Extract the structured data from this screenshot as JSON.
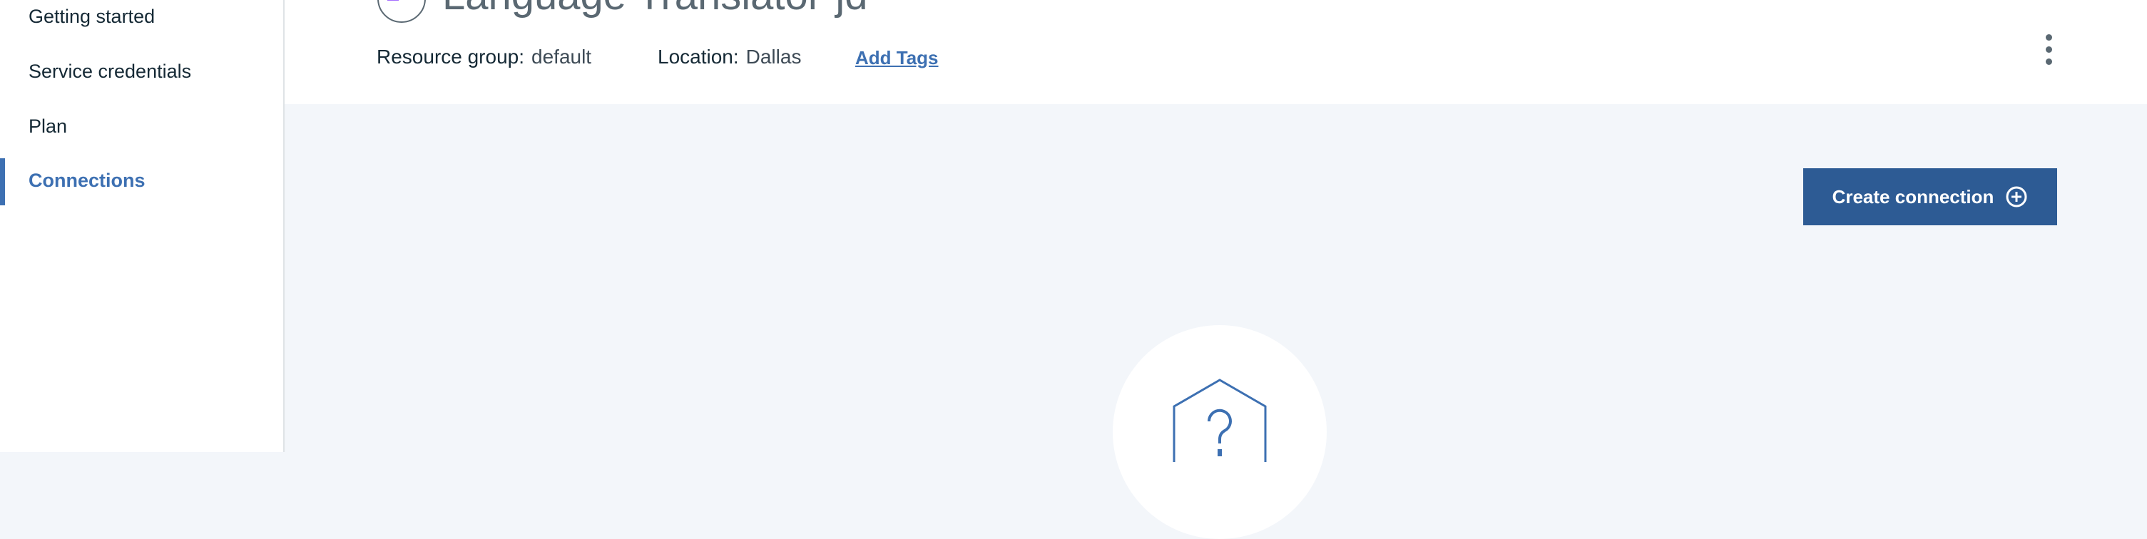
{
  "sidebar": {
    "items": [
      {
        "label": "Getting started",
        "active": false
      },
      {
        "label": "Service credentials",
        "active": false
      },
      {
        "label": "Plan",
        "active": false
      },
      {
        "label": "Connections",
        "active": true
      }
    ]
  },
  "header": {
    "title": "Language Translator-jd",
    "service_icon": "language-translator-icon",
    "resource_group_label": "Resource group:",
    "resource_group_value": "default",
    "location_label": "Location:",
    "location_value": "Dallas",
    "add_tags_label": "Add Tags",
    "menu_icon": "overflow-menu-vertical-icon"
  },
  "main": {
    "create_connection_label": "Create connection",
    "create_connection_icon": "add-circle-icon",
    "empty_state_icon": "question-hexagon-icon"
  },
  "colors": {
    "accent": "#3d70b2",
    "button": "#2d5b94",
    "background": "#f3f6fa",
    "icon_purple": "#a56eff"
  }
}
